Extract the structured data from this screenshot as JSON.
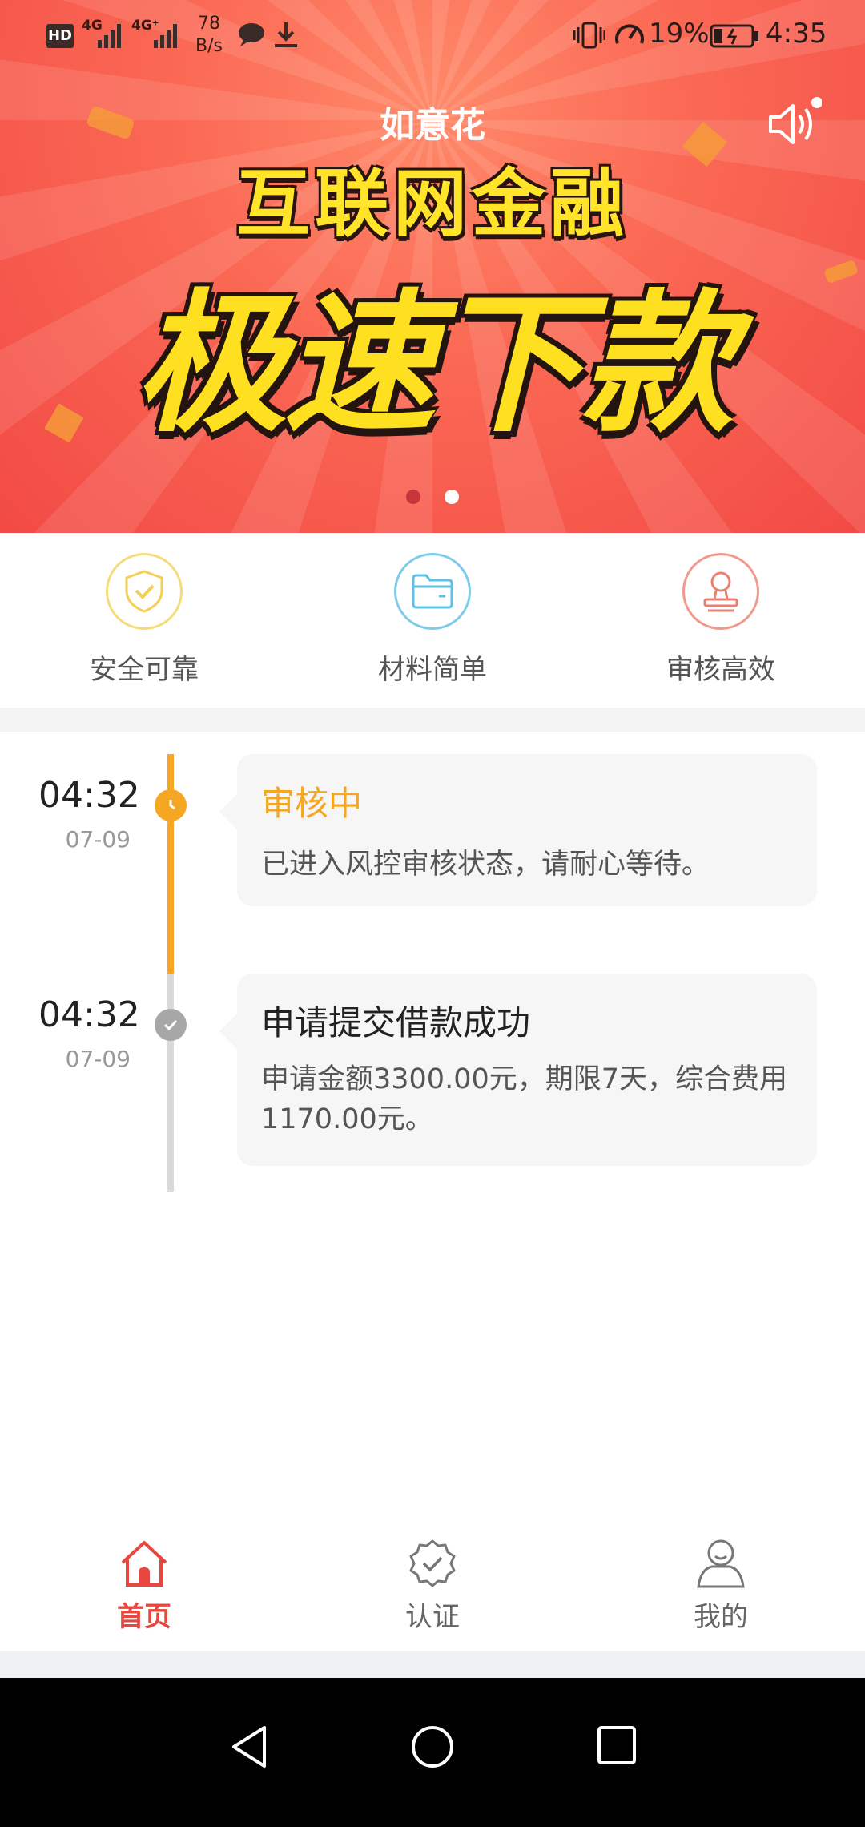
{
  "status_bar": {
    "network_1": "4G",
    "network_2": "4G⁺",
    "speed_value": "78",
    "speed_unit": "B/s",
    "battery": "19%",
    "time": "4:35"
  },
  "banner": {
    "app_name": "如意花",
    "headline": "互联网金融",
    "slogan": "极速下款",
    "slides_total": 2,
    "slide_active": 1
  },
  "features": [
    {
      "label": "安全可靠",
      "icon": "shield-check-icon",
      "color": "#f5d55a"
    },
    {
      "label": "材料简单",
      "icon": "folder-icon",
      "color": "#6cc6e8"
    },
    {
      "label": "审核高效",
      "icon": "stamp-icon",
      "color": "#ec8a7a"
    }
  ],
  "timeline": [
    {
      "time": "04:32",
      "date": "07-09",
      "title": "审核中",
      "desc": "已进入风控审核状态，请耐心等待。",
      "state": "current",
      "color": "#f5a623"
    },
    {
      "time": "04:32",
      "date": "07-09",
      "title": "申请提交借款成功",
      "desc": "申请金额3300.00元，期限7天，综合费用1170.00元。",
      "state": "done",
      "color": "#222222"
    }
  ],
  "bottom_nav": [
    {
      "label": "首页",
      "icon": "home-icon",
      "active": true
    },
    {
      "label": "认证",
      "icon": "verify-badge-icon",
      "active": false
    },
    {
      "label": "我的",
      "icon": "user-icon",
      "active": false
    }
  ],
  "colors": {
    "accent": "#e8473f",
    "timeline_active": "#f5a623",
    "timeline_inactive": "#d9d9d9"
  }
}
